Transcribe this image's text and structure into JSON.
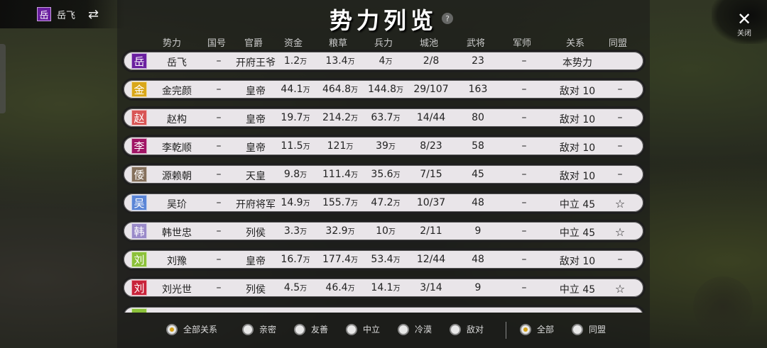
{
  "player": {
    "badge": "岳",
    "name": "岳飞",
    "swap_icon": "⇄"
  },
  "title": "势力列览",
  "help": "?",
  "close": {
    "icon": "✕",
    "label": "关闭"
  },
  "columns": [
    "势力",
    "国号",
    "官爵",
    "资金",
    "粮草",
    "兵力",
    "城池",
    "武将",
    "军师",
    "关系",
    "同盟"
  ],
  "rows": [
    {
      "flag": "岳",
      "color": "#6a1fa0",
      "name": "岳飞",
      "guohao": "–",
      "guanjue": "开府王爷",
      "zijin": "1.2",
      "liangcao": "13.4",
      "bingli": "4",
      "chengchi": "2/8",
      "wujiang": "23",
      "junshi": "–",
      "guanxi": "本势力",
      "tongmeng": ""
    },
    {
      "flag": "金",
      "color": "#d9a71a",
      "name": "金完颜",
      "guohao": "–",
      "guanjue": "皇帝",
      "zijin": "44.1",
      "liangcao": "464.8",
      "bingli": "144.8",
      "chengchi": "29/107",
      "wujiang": "163",
      "junshi": "–",
      "guanxi": "敌对 10",
      "tongmeng": "–"
    },
    {
      "flag": "赵",
      "color": "#d85555",
      "name": "赵构",
      "guohao": "–",
      "guanjue": "皇帝",
      "zijin": "19.7",
      "liangcao": "214.2",
      "bingli": "63.7",
      "chengchi": "14/44",
      "wujiang": "80",
      "junshi": "–",
      "guanxi": "敌对 10",
      "tongmeng": "–"
    },
    {
      "flag": "李",
      "color": "#a01565",
      "name": "李乾顺",
      "guohao": "–",
      "guanjue": "皇帝",
      "zijin": "11.5",
      "liangcao": "121",
      "bingli": "39",
      "chengchi": "8/23",
      "wujiang": "58",
      "junshi": "–",
      "guanxi": "敌对 10",
      "tongmeng": "–"
    },
    {
      "flag": "倭",
      "color": "#85705c",
      "name": "源赖朝",
      "guohao": "–",
      "guanjue": "天皇",
      "zijin": "9.8",
      "liangcao": "111.4",
      "bingli": "35.6",
      "chengchi": "7/15",
      "wujiang": "45",
      "junshi": "–",
      "guanxi": "敌对 10",
      "tongmeng": "–"
    },
    {
      "flag": "吴",
      "color": "#5b85d6",
      "name": "吴玠",
      "guohao": "–",
      "guanjue": "开府将军",
      "zijin": "14.9",
      "liangcao": "155.7",
      "bingli": "47.2",
      "chengchi": "10/37",
      "wujiang": "48",
      "junshi": "–",
      "guanxi": "中立 45",
      "tongmeng": "☆"
    },
    {
      "flag": "韩",
      "color": "#9a8ac9",
      "name": "韩世忠",
      "guohao": "–",
      "guanjue": "列侯",
      "zijin": "3.3",
      "liangcao": "32.9",
      "bingli": "10",
      "chengchi": "2/11",
      "wujiang": "9",
      "junshi": "–",
      "guanxi": "中立 45",
      "tongmeng": "☆"
    },
    {
      "flag": "刘",
      "color": "#8cc13a",
      "name": "刘豫",
      "guohao": "–",
      "guanjue": "皇帝",
      "zijin": "16.7",
      "liangcao": "177.4",
      "bingli": "53.4",
      "chengchi": "12/44",
      "wujiang": "48",
      "junshi": "–",
      "guanxi": "敌对 10",
      "tongmeng": "–"
    },
    {
      "flag": "刘",
      "color": "#c8233a",
      "name": "刘光世",
      "guohao": "–",
      "guanjue": "列侯",
      "zijin": "4.5",
      "liangcao": "46.4",
      "bingli": "14.1",
      "chengchi": "3/14",
      "wujiang": "9",
      "junshi": "–",
      "guanxi": "中立 45",
      "tongmeng": "☆"
    },
    {
      "flag": "",
      "color": "#8cc13a",
      "name": "",
      "guohao": "",
      "guanjue": "",
      "zijin": "",
      "liangcao": "",
      "bingli": "",
      "chengchi": "",
      "wujiang": "",
      "junshi": "",
      "guanxi": "",
      "tongmeng": ""
    }
  ],
  "unit": "万",
  "filter": {
    "relation": [
      {
        "label": "全部关系",
        "on": true
      },
      {
        "label": "亲密",
        "on": false
      },
      {
        "label": "友善",
        "on": false
      },
      {
        "label": "中立",
        "on": false
      },
      {
        "label": "冷漠",
        "on": false
      },
      {
        "label": "敌对",
        "on": false
      }
    ],
    "alliance": [
      {
        "label": "全部",
        "on": true
      },
      {
        "label": "同盟",
        "on": false
      }
    ]
  }
}
